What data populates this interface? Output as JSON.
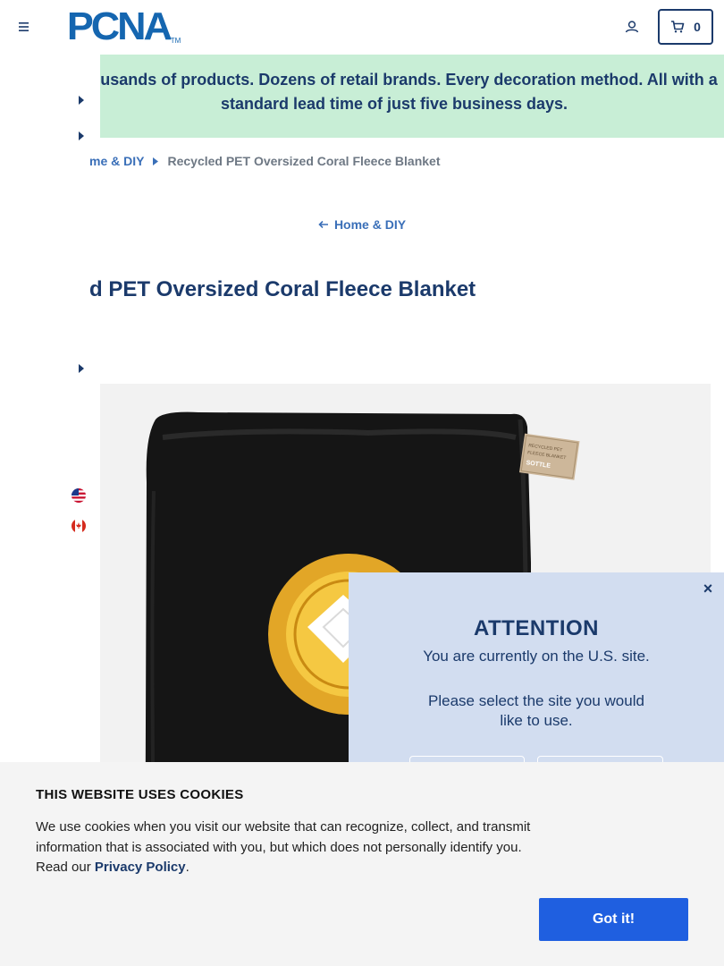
{
  "header": {
    "logo_text": "PCNA",
    "logo_tm": "TM",
    "cart_count": "0"
  },
  "promo": {
    "text": "Thousands of products. Dozens of retail brands. Every decoration method. All with a standard lead time of just five business days."
  },
  "breadcrumb": {
    "parent": "me & DIY",
    "current": "Recycled PET Oversized Coral Fleece Blanket"
  },
  "back_link": {
    "label": "Home & DIY"
  },
  "product": {
    "title": "d PET Oversized Coral Fleece Blanket",
    "tag_text": "SOTTLE"
  },
  "attention": {
    "close": "×",
    "title": "ATTENTION",
    "message": "You are currently on the U.S. site.",
    "prompt": "Please select the site you would like to use."
  },
  "cookie": {
    "title": "THIS WEBSITE USES COOKIES",
    "body_before": "We use cookies when you visit our website that can recognize, collect, and transmit information that is associated with you, but which does not personally identify you. Read our ",
    "link": "Privacy Policy",
    "body_after": ".",
    "button": "Got it!"
  },
  "colors": {
    "brand_blue": "#1566b0",
    "navy": "#1b3a6b",
    "promo_bg": "#c8eed6",
    "modal_bg": "#d2ddf0",
    "cookie_button": "#1f5fe0"
  }
}
